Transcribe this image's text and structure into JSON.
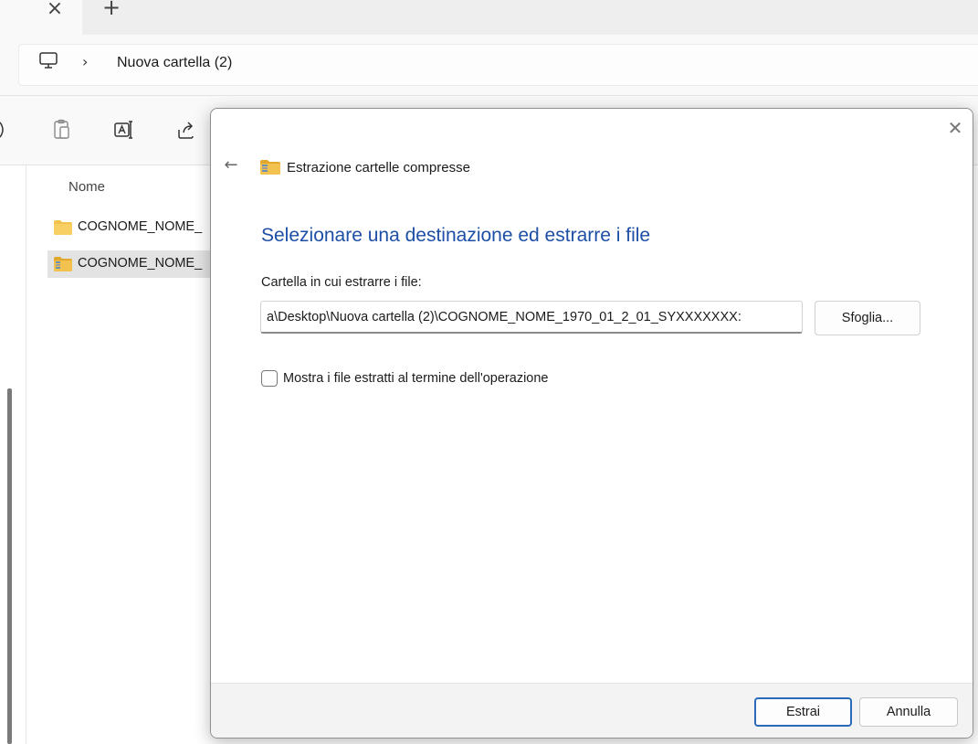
{
  "window": {
    "tab_close_glyph": "×",
    "tab_new_glyph": "+"
  },
  "address": {
    "chevron": "›",
    "breadcrumb": "Nuova cartella (2)"
  },
  "file_list": {
    "column_header": "Nome",
    "items": [
      {
        "name": "COGNOME_NOME_",
        "icon": "folder-icon",
        "selected": false
      },
      {
        "name": "COGNOME_NOME_",
        "icon": "zip-folder-icon",
        "selected": true
      }
    ]
  },
  "dialog": {
    "close_glyph": "✕",
    "back_glyph": "←",
    "title": "Estrazione cartelle compresse",
    "heading": "Selezionare una destinazione ed estrarre i file",
    "destination_label": "Cartella in cui estrarre i file:",
    "destination_value": ":a\\Desktop\\Nuova cartella (2)\\COGNOME_NOME_1970_01_2_01_SYXXXXXXX",
    "browse_label": "Sfoglia...",
    "show_files_label": "Mostra i file estratti al termine dell'operazione",
    "show_files_checked": false,
    "extract_label": "Estrai",
    "cancel_label": "Annulla"
  },
  "colors": {
    "accent": "#1d4fa6",
    "primary_button_border": "#2a6ab8",
    "folder": "#f2c14e"
  }
}
